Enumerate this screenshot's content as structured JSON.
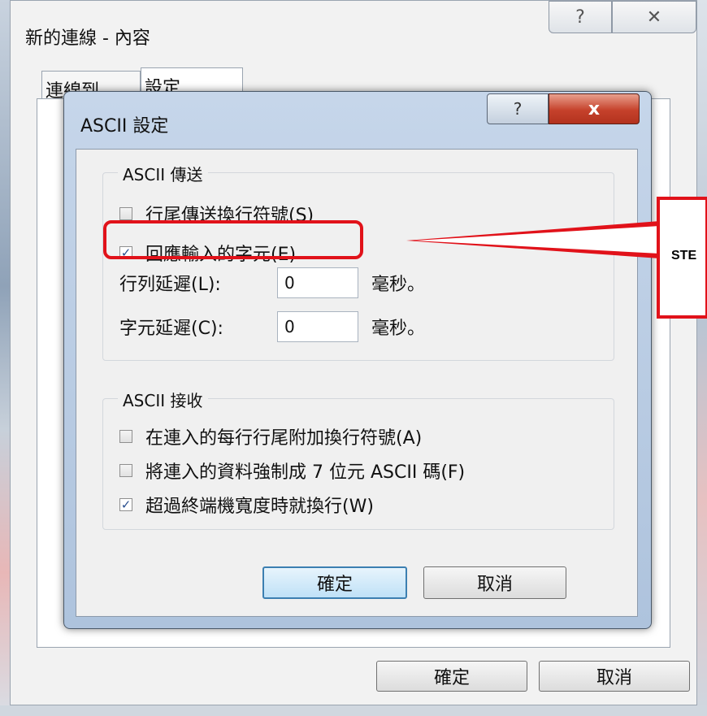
{
  "outer_window": {
    "title": "新的連線 - 內容",
    "help_label": "?",
    "close_label": "✕",
    "tabs": [
      {
        "label": "連線到"
      },
      {
        "label": "設定"
      }
    ],
    "ok_label": "確定",
    "cancel_label": "取消"
  },
  "dialog": {
    "title": "ASCII 設定",
    "help_label": "?",
    "close_label": "x",
    "send_group": {
      "title": "ASCII 傳送",
      "options": [
        {
          "label": "行尾傳送換行符號(S)",
          "checked": false
        },
        {
          "label": "回應輸入的字元(E)",
          "checked": true
        }
      ],
      "line_delay_label": "行列延遲(L):",
      "line_delay_value": "0",
      "line_delay_unit": "毫秒。",
      "char_delay_label": "字元延遲(C):",
      "char_delay_value": "0",
      "char_delay_unit": "毫秒。"
    },
    "receive_group": {
      "title": "ASCII 接收",
      "options": [
        {
          "label": "在連入的每行行尾附加換行符號(A)",
          "checked": false
        },
        {
          "label": "將連入的資料強制成 7 位元 ASCII 碼(F)",
          "checked": false
        },
        {
          "label": "超過終端機寬度時就換行(W)",
          "checked": true
        }
      ]
    },
    "ok_label": "確定",
    "cancel_label": "取消"
  },
  "callout": {
    "text": "STE",
    "color": "#e1121a"
  },
  "colors": {
    "highlight": "#e1121a",
    "checkmark": "#2a4f8e",
    "dialog_close": "#c5412b"
  }
}
